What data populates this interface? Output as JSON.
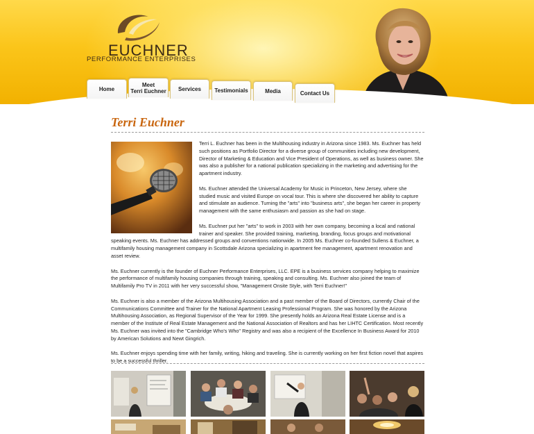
{
  "header": {
    "logo": {
      "name": "EUCHNER",
      "tagline": "PERFORMANCE ENTERPRISES",
      "swoosh_colors": [
        "#6b4a26",
        "#f6e7b0"
      ]
    },
    "colors": {
      "accent": "#fbc51a",
      "title": "#c9660f"
    },
    "portrait_icon": "person-portrait"
  },
  "nav": {
    "tabs": [
      {
        "label": "Home"
      },
      {
        "label": "Meet\nTerri Euchner"
      },
      {
        "label": "Services"
      },
      {
        "label": "Testimonials"
      },
      {
        "label": "Media"
      },
      {
        "label": "Contact Us"
      }
    ]
  },
  "main": {
    "title": "Terri Euchner",
    "feature_photo": "microphone-photo",
    "paragraphs": [
      "Terri L. Euchner has been in the Multihousing industry in Arizona since 1983. Ms. Euchner has held such positions as Portfolio Director for a diverse group of communities including new development, Director of Marketing & Education and Vice President of Operations, as well as business owner. She was also a publisher for a national publication specializing in the marketing and advertising for the apartment industry.",
      "Ms. Euchner attended the Universal Academy for Music in Princeton, New Jersey, where she studied music and visited Europe on vocal tour. This is where she discovered her ability to capture and stimulate an audience. Turning the \"arts\" into \"business arts\", she began her career in property management with the same enthusiasm and passion as she had on stage.",
      "Ms. Euchner put her \"arts\" to work in 2003 with her own company, becoming a local and national trainer and speaker. She provided training, marketing, branding, focus groups and motivational speaking events. Ms. Euchner has addressed groups and conventions nationwide. In 2005 Ms. Euchner co-founded Sullens & Euchner, a multifamily housing management company in Scottsdale Arizona specializing in apartment fee management, apartment renovation and asset review.",
      "Ms. Euchner currently is the founder of Euchner Performance Enterprises, LLC. EPE is a business services company helping to maximize the performance of multifamily housing companies through training, speaking and consulting. Ms. Euchner also joined the team of Multifamily Pro TV in 2011 with her very successful show, \"Management Onsite Style, with Terri Euchner!\"",
      "Ms. Euchner is also a member of the Arizona Multihousing Association and a past member of the Board of Directors, currently Chair of the Communications Committee and Trainer for the National Apartment Leasing Professional Program. She was honored by the Arizona Multihousing Association, as Regional Supervisor of the Year for 1999. She presently holds an Arizona Real Estate License and is a member of the Institute of Real Estate Management and the National Association of Realtors and has her LIHTC Certification. Most recently Ms. Euchner was invited into the \"Cambridge Who's Who\" Registry and was also a recipient of the Excellence In Business Award for 2010 by American Solutions and Newt Gingrich.",
      "Ms. Euchner enjoys spending time with her family, writing, hiking and traveling. She is currently working on her first fiction novel that aspires to be a successful thriller."
    ]
  },
  "gallery": {
    "thumbnails": [
      {
        "icon": "training-presentation-photo"
      },
      {
        "icon": "workshop-tables-photo"
      },
      {
        "icon": "presenter-at-screen-photo"
      },
      {
        "icon": "audience-raising-hands-photo"
      },
      {
        "icon": "conference-room-photo"
      },
      {
        "icon": "event-hall-photo"
      },
      {
        "icon": "seminar-group-photo"
      },
      {
        "icon": "chandelier-ballroom-photo"
      }
    ]
  }
}
